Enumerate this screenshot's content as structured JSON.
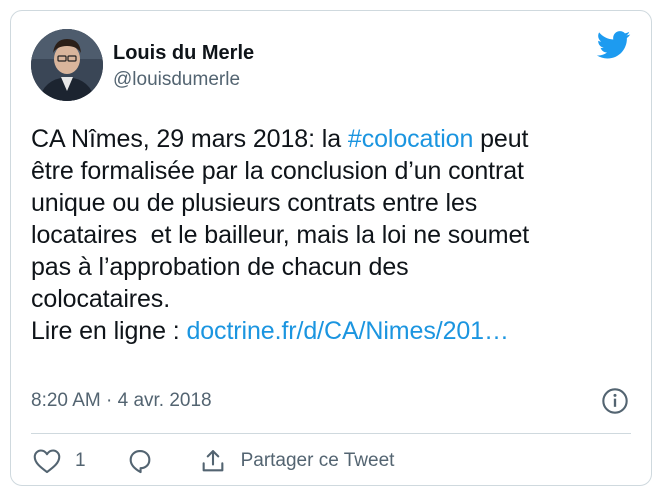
{
  "author": {
    "display_name": "Louis du Merle",
    "handle": "@louisdumerle",
    "avatar_icon": "person-avatar"
  },
  "tweet": {
    "line1_before": "CA Nîmes, 29 mars 2018: la ",
    "hashtag": "#colocation",
    "line1_after": " peut",
    "line2": "être formalisée par la conclusion d’un contrat",
    "line3": "unique ou de plusieurs contrats entre les",
    "line4": "locataires  et le bailleur, mais la loi ne soumet",
    "line5": "pas à l’approbation de chacun des",
    "line6": "colocataires.",
    "line7_prefix": "Lire en ligne : ",
    "link_text": "doctrine.fr/d/CA/Nimes/201…"
  },
  "meta": {
    "timestamp": "8:20 AM · 4 avr. 2018"
  },
  "actions": {
    "like_count": "1",
    "share_label": "Partager ce Tweet"
  },
  "colors": {
    "link": "#1b95e0",
    "twitter_blue": "#1d9bf0",
    "muted": "#536471",
    "border": "#cfd9de"
  },
  "icons": {
    "brand": "twitter-bird-icon",
    "info": "info-icon",
    "like": "heart-icon",
    "reply": "reply-bubble-icon",
    "share": "share-icon"
  }
}
